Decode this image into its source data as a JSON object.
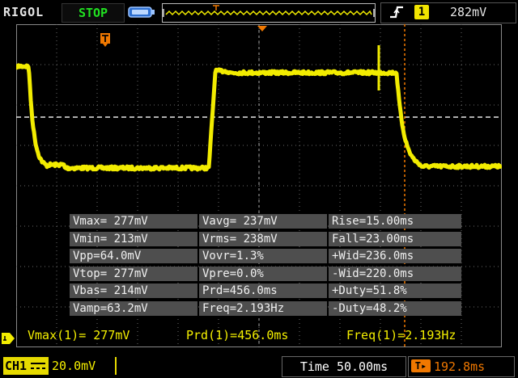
{
  "brand": "RIGOL",
  "run_state": "STOP",
  "trigger": {
    "source": "1",
    "level": "282mV",
    "marker_label": "T"
  },
  "measurements": [
    [
      "Vmax= 277mV",
      "Vavg= 237mV",
      "Rise=15.00ms"
    ],
    [
      "Vmin= 213mV",
      "Vrms= 238mV",
      "Fall=23.00ms"
    ],
    [
      "Vpp=64.0mV",
      "Vovr=1.3%",
      "+Wid=236.0ms"
    ],
    [
      "Vtop= 277mV",
      "Vpre=0.0%",
      "-Wid=220.0ms"
    ],
    [
      "Vbas= 214mV",
      "Prd=456.0ms",
      "+Duty=51.8%"
    ],
    [
      "Vamp=63.2mV",
      "Freq=2.193Hz",
      "-Duty=48.2%"
    ]
  ],
  "summary": {
    "vmax": "Vmax(1)= 277mV",
    "prd": "Prd(1)=456.0ms",
    "freq": "Freq(1)=2.193Hz"
  },
  "channel": {
    "label": "CH1",
    "scale": "20.0mV"
  },
  "timebase": "Time 50.00ms",
  "offset": "192.8ms",
  "colors": {
    "trace": "#f2ec00",
    "trigger": "#f07800",
    "grid": "#6a6a6a",
    "panel": "#4e4e4e"
  }
}
